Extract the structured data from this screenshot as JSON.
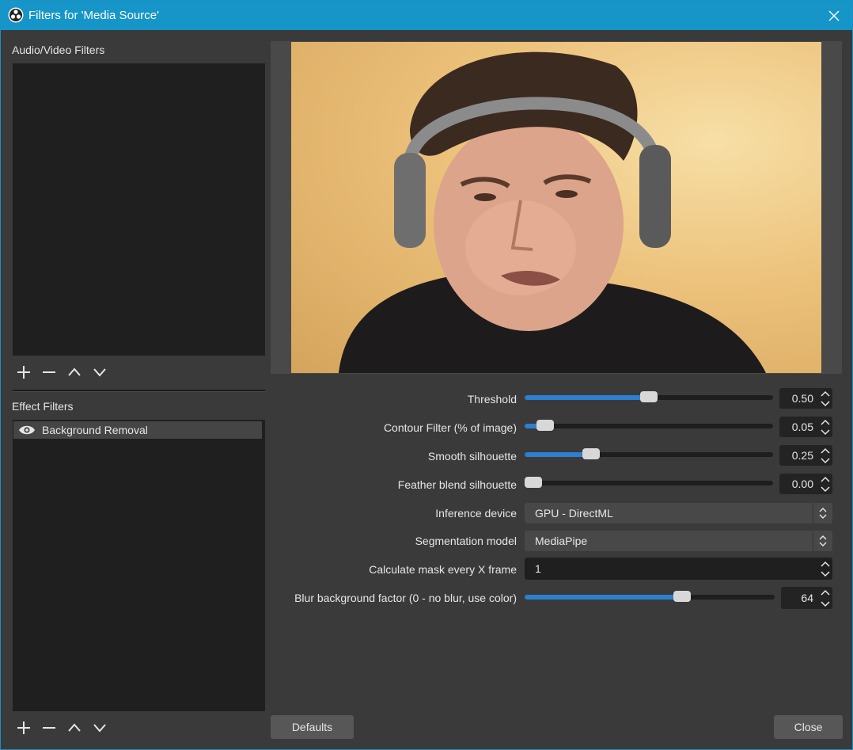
{
  "window": {
    "title": "Filters for 'Media Source'"
  },
  "av_filters": {
    "label": "Audio/Video Filters"
  },
  "effect_filters": {
    "label": "Effect Filters",
    "items": [
      {
        "name": "Background Removal",
        "visible": true
      }
    ]
  },
  "toolbar_icons": [
    "add-icon",
    "remove-icon",
    "move-up-icon",
    "move-down-icon"
  ],
  "properties": {
    "threshold": {
      "label": "Threshold",
      "value": "0.50",
      "fraction": 0.5
    },
    "contour": {
      "label": "Contour Filter (% of image)",
      "value": "0.05",
      "fraction": 0.05
    },
    "smooth": {
      "label": "Smooth silhouette",
      "value": "0.25",
      "fraction": 0.25
    },
    "feather": {
      "label": "Feather blend silhouette",
      "value": "0.00",
      "fraction": 0.0
    },
    "inference": {
      "label": "Inference device",
      "value": "GPU - DirectML"
    },
    "segmentation": {
      "label": "Segmentation model",
      "value": "MediaPipe"
    },
    "mask_every": {
      "label": "Calculate mask every X frame",
      "value": "1"
    },
    "blur": {
      "label": "Blur background factor (0 - no blur, use color)",
      "value": "64",
      "fraction": 0.64
    }
  },
  "buttons": {
    "defaults": "Defaults",
    "close": "Close"
  },
  "colors": {
    "titlebar": "#1696c8",
    "accent": "#2d7fd1",
    "panel": "#3a3a3a",
    "list": "#1f1f1f"
  }
}
